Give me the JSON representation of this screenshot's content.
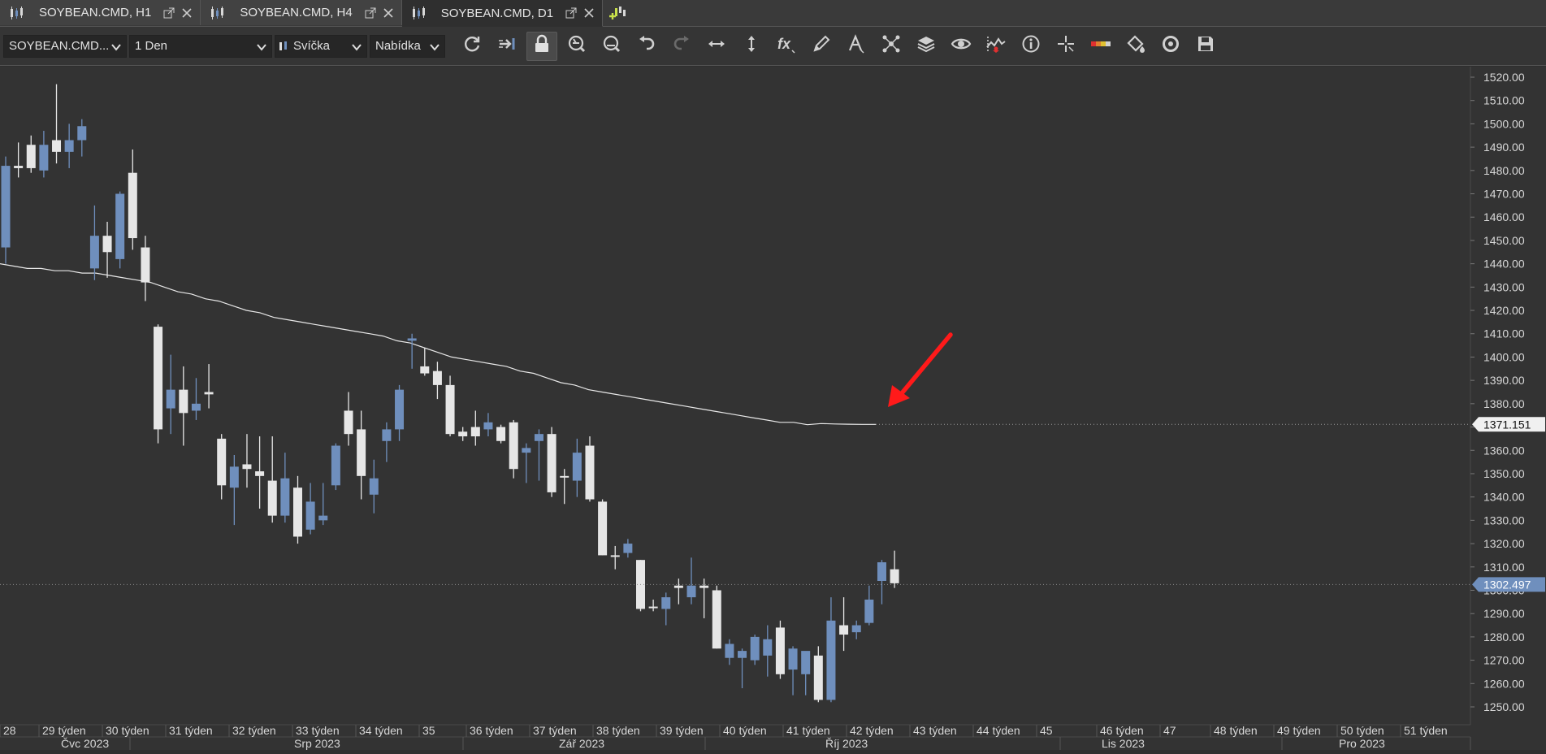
{
  "tabs": [
    {
      "label": "SOYBEAN.CMD, H1",
      "active": false
    },
    {
      "label": "SOYBEAN.CMD, H4",
      "active": false
    },
    {
      "label": "SOYBEAN.CMD, D1",
      "active": true
    }
  ],
  "toolbar": {
    "symbol": "SOYBEAN.CMD...",
    "timeframe": "1 Den",
    "chart_type": "Svíčka",
    "price_side": "Nabídka",
    "icons": [
      "refresh-icon",
      "shift-chart-icon",
      "lock-icon",
      "zoom-in-icon",
      "zoom-out-icon",
      "undo-icon",
      "redo-icon",
      "horizontal-resize-icon",
      "vertical-resize-icon",
      "indicator-fx-icon",
      "pencil-icon",
      "text-tool-icon",
      "objects-icon",
      "layers-icon",
      "eye-icon",
      "signals-icon",
      "info-icon",
      "crosshair-icon",
      "color-scale-icon",
      "fill-bucket-icon",
      "template-icon",
      "save-icon"
    ]
  },
  "chart_data": {
    "type": "candlestick",
    "y_labels": [
      "1520.00",
      "1510.00",
      "1500.00",
      "1490.00",
      "1480.00",
      "1470.00",
      "1460.00",
      "1450.00",
      "1440.00",
      "1430.00",
      "1420.00",
      "1410.00",
      "1400.00",
      "1390.00",
      "1380.00",
      "1370.00",
      "1360.00",
      "1350.00",
      "1340.00",
      "1330.00",
      "1320.00",
      "1310.00",
      "1300.00",
      "1290.00",
      "1280.00",
      "1270.00",
      "1260.00",
      "1250.00"
    ],
    "ylim": [
      1246,
      1523
    ],
    "current_price_label": "1302.497",
    "current_price": 1302.497,
    "ma_label": "1371.151",
    "ma_value": 1371.151,
    "week_labels": [
      "28",
      "29 týden",
      "30 týden",
      "31 týden",
      "32 týden",
      "33 týden",
      "34 týden",
      "35",
      "36 týden",
      "37 týden",
      "38 týden",
      "39 týden",
      "40 týden",
      "41 týden",
      "42 týden",
      "43 týden",
      "44 týden",
      "45",
      "46 týden",
      "47",
      "48 týden",
      "49 týden",
      "50 týden",
      "51 týden"
    ],
    "month_labels": [
      "Čvc 2023",
      "Srp 2023",
      "Zář 2023",
      "Říj 2023",
      "Lis 2023",
      "Pro 2023"
    ],
    "candles": [
      {
        "o": 1447,
        "h": 1486,
        "l": 1440,
        "c": 1482,
        "bull": true
      },
      {
        "o": 1482,
        "h": 1492,
        "l": 1477,
        "c": 1481,
        "bull": false
      },
      {
        "o": 1481,
        "h": 1495,
        "l": 1479,
        "c": 1491,
        "bull": false
      },
      {
        "o": 1480,
        "h": 1497,
        "l": 1477,
        "c": 1491,
        "bull": true
      },
      {
        "o": 1488,
        "h": 1517,
        "l": 1483,
        "c": 1493,
        "bull": false
      },
      {
        "o": 1488,
        "h": 1500,
        "l": 1481,
        "c": 1493,
        "bull": true
      },
      {
        "o": 1493,
        "h": 1502,
        "l": 1486,
        "c": 1499,
        "bull": true
      },
      {
        "o": 1438,
        "h": 1465,
        "l": 1433,
        "c": 1452,
        "bull": true
      },
      {
        "o": 1452,
        "h": 1458,
        "l": 1434,
        "c": 1445,
        "bull": false
      },
      {
        "o": 1442,
        "h": 1471,
        "l": 1438,
        "c": 1470,
        "bull": true
      },
      {
        "o": 1479,
        "h": 1489,
        "l": 1446,
        "c": 1451,
        "bull": false
      },
      {
        "o": 1447,
        "h": 1452,
        "l": 1424,
        "c": 1432,
        "bull": false
      },
      {
        "o": 1413,
        "h": 1414,
        "l": 1363,
        "c": 1369,
        "bull": false
      },
      {
        "o": 1378,
        "h": 1401,
        "l": 1367,
        "c": 1386,
        "bull": true
      },
      {
        "o": 1386,
        "h": 1396,
        "l": 1362,
        "c": 1376,
        "bull": false
      },
      {
        "o": 1377,
        "h": 1391,
        "l": 1373,
        "c": 1380,
        "bull": true
      },
      {
        "o": 1385,
        "h": 1397,
        "l": 1378,
        "c": 1384,
        "bull": false
      },
      {
        "o": 1365,
        "h": 1367,
        "l": 1339,
        "c": 1345,
        "bull": false
      },
      {
        "o": 1344,
        "h": 1358,
        "l": 1328,
        "c": 1353,
        "bull": true
      },
      {
        "o": 1354,
        "h": 1367,
        "l": 1344,
        "c": 1352,
        "bull": false
      },
      {
        "o": 1351,
        "h": 1366,
        "l": 1335,
        "c": 1349,
        "bull": false
      },
      {
        "o": 1347,
        "h": 1366,
        "l": 1329,
        "c": 1332,
        "bull": false
      },
      {
        "o": 1332,
        "h": 1359,
        "l": 1329,
        "c": 1348,
        "bull": true
      },
      {
        "o": 1344,
        "h": 1349,
        "l": 1320,
        "c": 1323,
        "bull": false
      },
      {
        "o": 1326,
        "h": 1346,
        "l": 1324,
        "c": 1338,
        "bull": true
      },
      {
        "o": 1330,
        "h": 1346,
        "l": 1328,
        "c": 1332,
        "bull": true
      },
      {
        "o": 1345,
        "h": 1363,
        "l": 1343,
        "c": 1362,
        "bull": true
      },
      {
        "o": 1377,
        "h": 1385,
        "l": 1362,
        "c": 1367,
        "bull": false
      },
      {
        "o": 1369,
        "h": 1377,
        "l": 1339,
        "c": 1349,
        "bull": false
      },
      {
        "o": 1348,
        "h": 1356,
        "l": 1333,
        "c": 1341,
        "bull": true
      },
      {
        "o": 1364,
        "h": 1372,
        "l": 1355,
        "c": 1369,
        "bull": true
      },
      {
        "o": 1369,
        "h": 1388,
        "l": 1364,
        "c": 1386,
        "bull": true
      },
      {
        "o": 1408,
        "h": 1410,
        "l": 1395,
        "c": 1407,
        "bull": true
      },
      {
        "o": 1396,
        "h": 1404,
        "l": 1392,
        "c": 1393,
        "bull": false
      },
      {
        "o": 1394,
        "h": 1398,
        "l": 1382,
        "c": 1388,
        "bull": false
      },
      {
        "o": 1388,
        "h": 1392,
        "l": 1366,
        "c": 1367,
        "bull": false
      },
      {
        "o": 1368,
        "h": 1370,
        "l": 1364,
        "c": 1366,
        "bull": false
      },
      {
        "o": 1370,
        "h": 1377,
        "l": 1362,
        "c": 1366,
        "bull": false
      },
      {
        "o": 1369,
        "h": 1376,
        "l": 1366,
        "c": 1372,
        "bull": true
      },
      {
        "o": 1370,
        "h": 1371,
        "l": 1363,
        "c": 1364,
        "bull": false
      },
      {
        "o": 1372,
        "h": 1373,
        "l": 1348,
        "c": 1352,
        "bull": false
      },
      {
        "o": 1359,
        "h": 1363,
        "l": 1346,
        "c": 1361,
        "bull": true
      },
      {
        "o": 1367,
        "h": 1369,
        "l": 1347,
        "c": 1364,
        "bull": true
      },
      {
        "o": 1367,
        "h": 1370,
        "l": 1340,
        "c": 1342,
        "bull": false
      },
      {
        "o": 1349,
        "h": 1352,
        "l": 1337,
        "c": 1349,
        "bull": false
      },
      {
        "o": 1359,
        "h": 1365,
        "l": 1340,
        "c": 1347,
        "bull": true
      },
      {
        "o": 1362,
        "h": 1366,
        "l": 1338,
        "c": 1339,
        "bull": false
      },
      {
        "o": 1338,
        "h": 1339,
        "l": 1315,
        "c": 1315,
        "bull": false
      },
      {
        "o": 1315,
        "h": 1319,
        "l": 1309,
        "c": 1315,
        "bull": false
      },
      {
        "o": 1316,
        "h": 1322,
        "l": 1314,
        "c": 1320,
        "bull": true
      },
      {
        "o": 1313,
        "h": 1313,
        "l": 1291,
        "c": 1292,
        "bull": false
      },
      {
        "o": 1293,
        "h": 1296,
        "l": 1291,
        "c": 1293,
        "bull": false
      },
      {
        "o": 1292,
        "h": 1299,
        "l": 1285,
        "c": 1297,
        "bull": true
      },
      {
        "o": 1301,
        "h": 1305,
        "l": 1294,
        "c": 1302,
        "bull": false
      },
      {
        "o": 1297,
        "h": 1314,
        "l": 1294,
        "c": 1302,
        "bull": true
      },
      {
        "o": 1302,
        "h": 1305,
        "l": 1288,
        "c": 1301,
        "bull": false
      },
      {
        "o": 1300,
        "h": 1302,
        "l": 1275,
        "c": 1275,
        "bull": false
      },
      {
        "o": 1271,
        "h": 1279,
        "l": 1268,
        "c": 1277,
        "bull": true
      },
      {
        "o": 1271,
        "h": 1275,
        "l": 1258,
        "c": 1274,
        "bull": true
      },
      {
        "o": 1270,
        "h": 1281,
        "l": 1268,
        "c": 1280,
        "bull": true
      },
      {
        "o": 1272,
        "h": 1285,
        "l": 1263,
        "c": 1279,
        "bull": true
      },
      {
        "o": 1284,
        "h": 1287,
        "l": 1262,
        "c": 1264,
        "bull": false
      },
      {
        "o": 1266,
        "h": 1276,
        "l": 1255,
        "c": 1275,
        "bull": true
      },
      {
        "o": 1264,
        "h": 1272,
        "l": 1255,
        "c": 1274,
        "bull": true
      },
      {
        "o": 1272,
        "h": 1276,
        "l": 1252,
        "c": 1253,
        "bull": false
      },
      {
        "o": 1253,
        "h": 1297,
        "l": 1252,
        "c": 1287,
        "bull": true
      },
      {
        "o": 1281,
        "h": 1297,
        "l": 1274,
        "c": 1285,
        "bull": false
      },
      {
        "o": 1282,
        "h": 1287,
        "l": 1279,
        "c": 1285,
        "bull": true
      },
      {
        "o": 1286,
        "h": 1302,
        "l": 1285,
        "c": 1296,
        "bull": true
      },
      {
        "o": 1304,
        "h": 1313,
        "l": 1294,
        "c": 1312,
        "bull": true
      },
      {
        "o": 1309,
        "h": 1317,
        "l": 1301,
        "c": 1303,
        "bull": false
      }
    ],
    "ma_line": [
      1440,
      1439,
      1438,
      1438,
      1437,
      1437,
      1436,
      1436,
      1435,
      1434,
      1433,
      1432,
      1430,
      1428,
      1427,
      1425,
      1424,
      1422,
      1420,
      1419,
      1417,
      1416,
      1415,
      1414,
      1413,
      1412,
      1411,
      1410,
      1409,
      1407,
      1406,
      1404,
      1402,
      1400,
      1399,
      1398,
      1397,
      1396,
      1394,
      1393,
      1391,
      1389,
      1388,
      1386,
      1385,
      1384,
      1383,
      1382,
      1381,
      1380,
      1379,
      1378,
      1377,
      1376,
      1375,
      1374,
      1373,
      1372,
      1372,
      1371,
      1371.5,
      1371.3,
      1371.2,
      1371.15,
      1371.151
    ],
    "colors": {
      "bull": "#6f8fbd",
      "bear": "#e6e6e6",
      "bg": "#2f2f2f",
      "grid": "#3a3a3a",
      "arrow": "#ff1a1a",
      "price_tag": "#6f8fbd"
    }
  }
}
